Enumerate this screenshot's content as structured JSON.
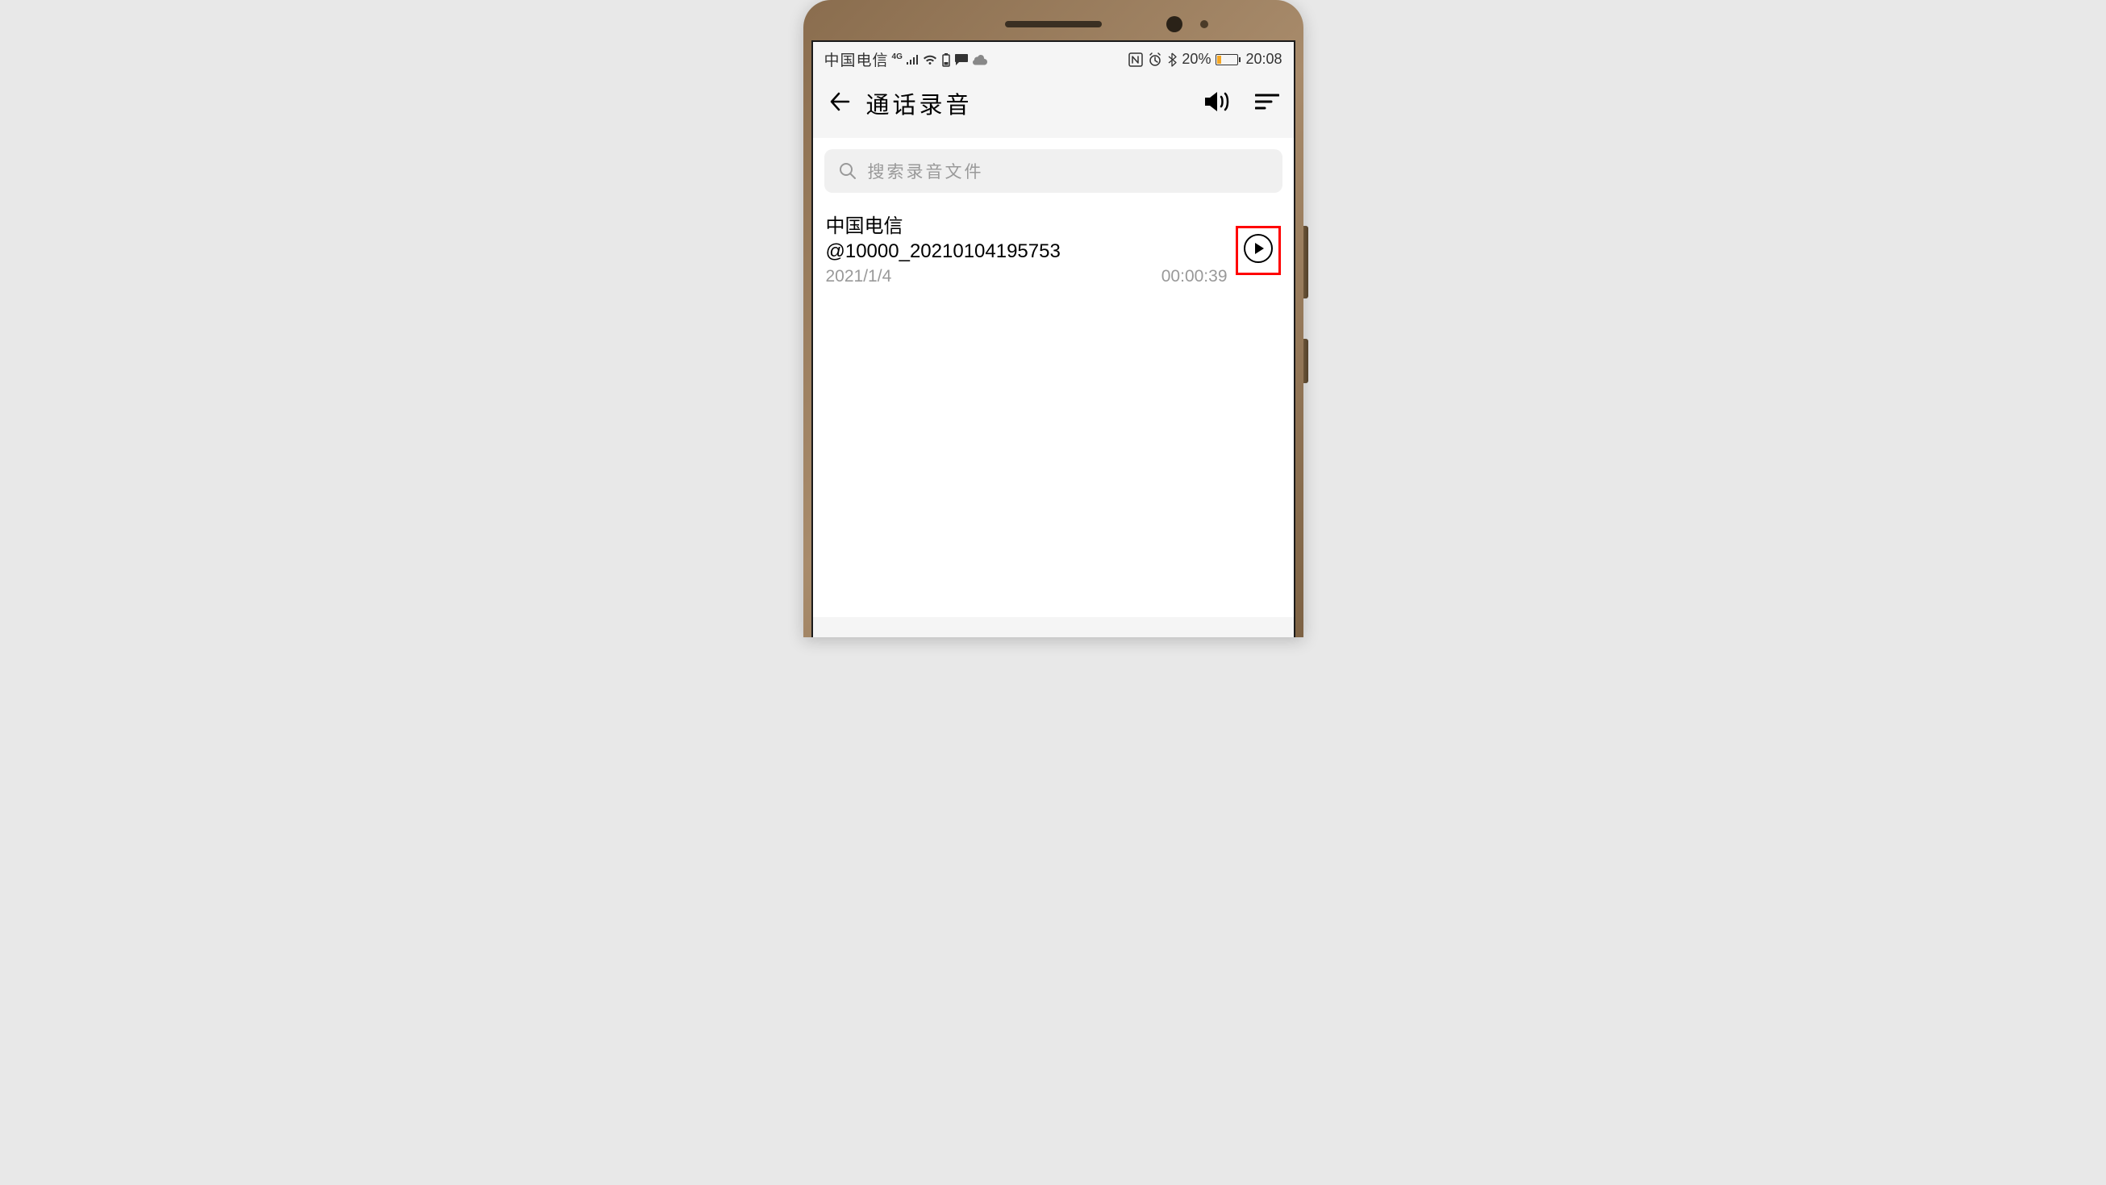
{
  "status_bar": {
    "carrier": "中国电信",
    "network_type": "4G",
    "battery_percent": "20%",
    "time": "20:08"
  },
  "header": {
    "title": "通话录音"
  },
  "search": {
    "placeholder": "搜索录音文件"
  },
  "recordings": [
    {
      "title_line1": "中国电信",
      "title_line2": "@10000_20210104195753",
      "date": "2021/1/4",
      "duration": "00:00:39"
    }
  ]
}
